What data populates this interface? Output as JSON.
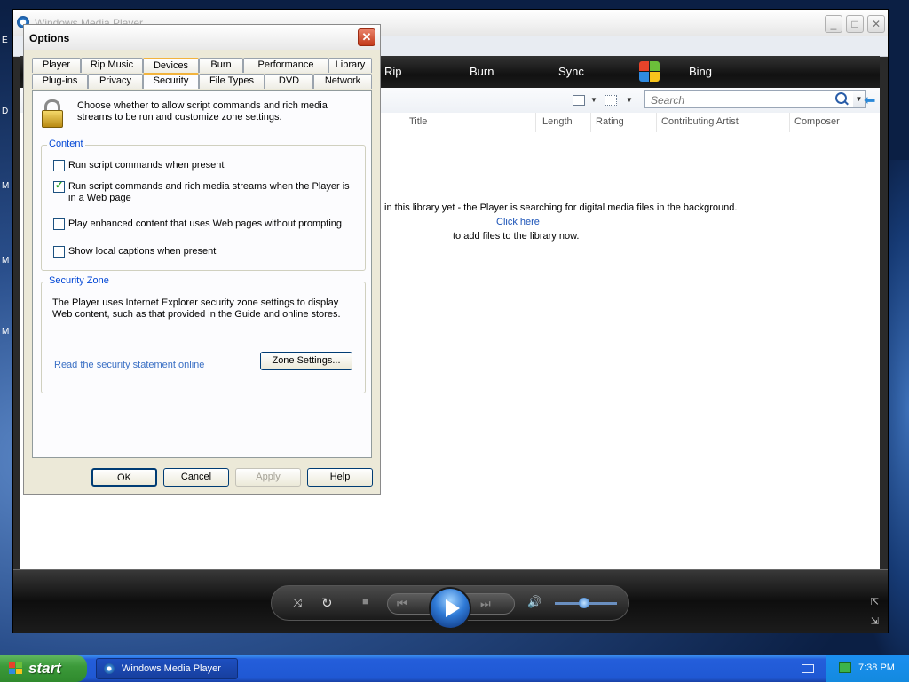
{
  "wmp": {
    "title": "Windows Media Player",
    "nav_tabs": [
      "Rip",
      "Burn",
      "Sync",
      "Bing"
    ],
    "search": {
      "placeholder": "Search"
    },
    "columns": [
      "Title",
      "Length",
      "Rating",
      "Contributing Artist",
      "Composer"
    ],
    "message_line1": "in this library yet - the Player is searching for digital media files in the background.",
    "message_link": "Click here",
    "message_line2": "to add files to the library now."
  },
  "dialog": {
    "title": "Options",
    "close_label": "✕",
    "tabs_row1": [
      "Player",
      "Rip Music",
      "Devices",
      "Burn",
      "Performance",
      "Library"
    ],
    "tabs_row2": [
      "Plug-ins",
      "Privacy",
      "Security",
      "File Types",
      "DVD",
      "Network"
    ],
    "active_tab": "Security",
    "intro": "Choose whether to allow script commands and rich media streams to be run and customize zone settings.",
    "content_group": {
      "title": "Content",
      "options": [
        {
          "label": "Run script commands when present",
          "checked": false
        },
        {
          "label": "Run script commands and rich media streams when the Player is in a Web page",
          "checked": true
        },
        {
          "label": "Play enhanced content that uses Web pages without prompting",
          "checked": false
        },
        {
          "label": "Show local captions when present",
          "checked": false
        }
      ]
    },
    "zone_group": {
      "title": "Security Zone",
      "text": "The Player uses Internet Explorer security zone settings to display Web content, such as that provided in the Guide and online stores.",
      "link": "Read the security statement online",
      "button": "Zone Settings..."
    },
    "buttons": {
      "ok": "OK",
      "cancel": "Cancel",
      "apply": "Apply",
      "help": "Help"
    }
  },
  "taskbar": {
    "start_label": "start",
    "task_label": "Windows Media Player",
    "clock": "7:38 PM"
  },
  "colors": {
    "link": "#1c54b8",
    "group_title": "#0046d5",
    "taskbar": "#245edb",
    "start_button": "#3c9a3a",
    "active_tab_accent": "#f2b33d"
  }
}
